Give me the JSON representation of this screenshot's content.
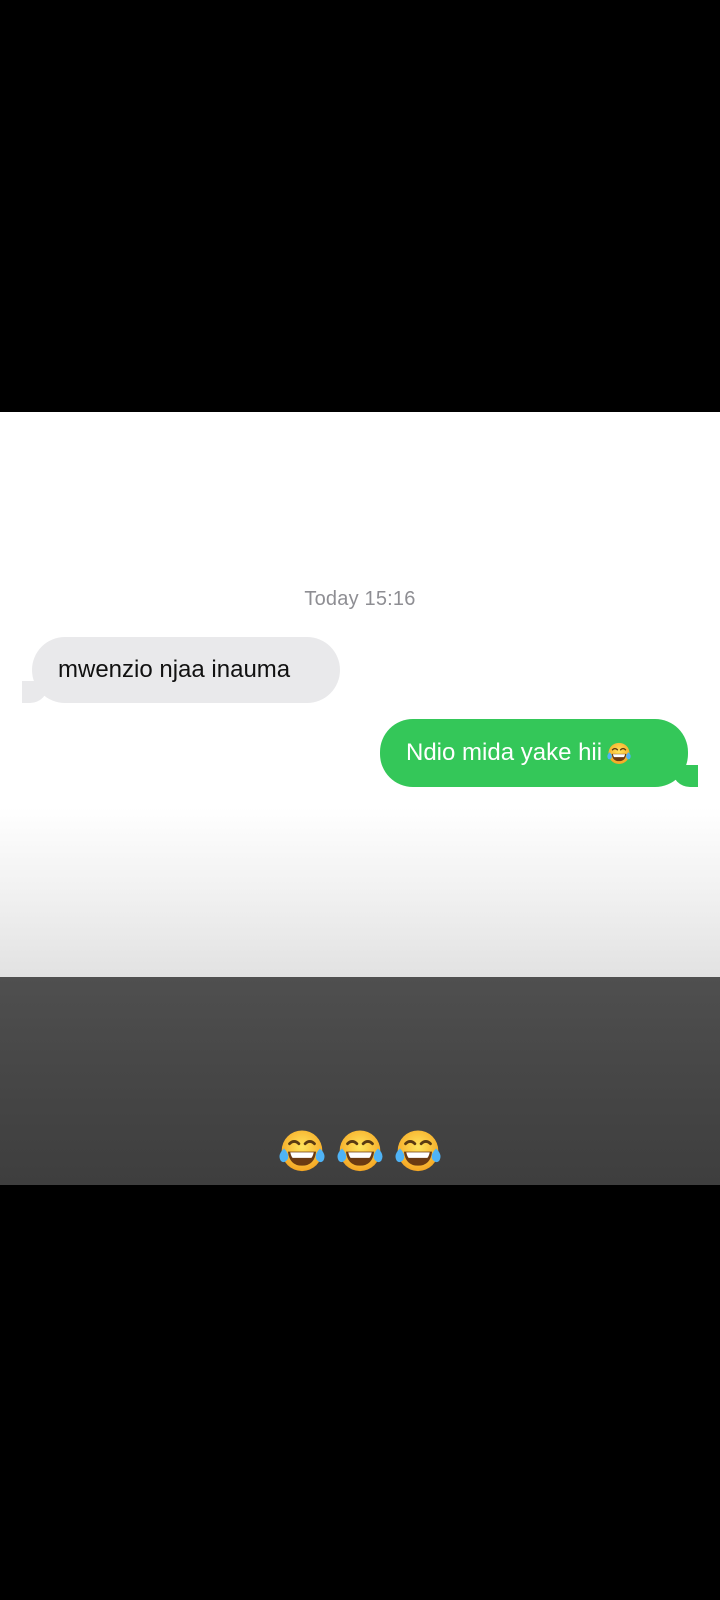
{
  "conversation": {
    "timestamp": "Today 15:16",
    "messages": [
      {
        "direction": "incoming",
        "text": "mwenzio njaa inauma"
      },
      {
        "direction": "outgoing",
        "text": "Ndio mida yake hii",
        "emoji": "tears-of-joy-icon"
      }
    ],
    "colors": {
      "incoming_bubble": "#e9e9eb",
      "outgoing_bubble": "#34c759",
      "timestamp_text": "#8e8e93"
    }
  },
  "caption": {
    "emojis": [
      "tears-of-joy-icon",
      "tears-of-joy-icon",
      "tears-of-joy-icon"
    ]
  }
}
